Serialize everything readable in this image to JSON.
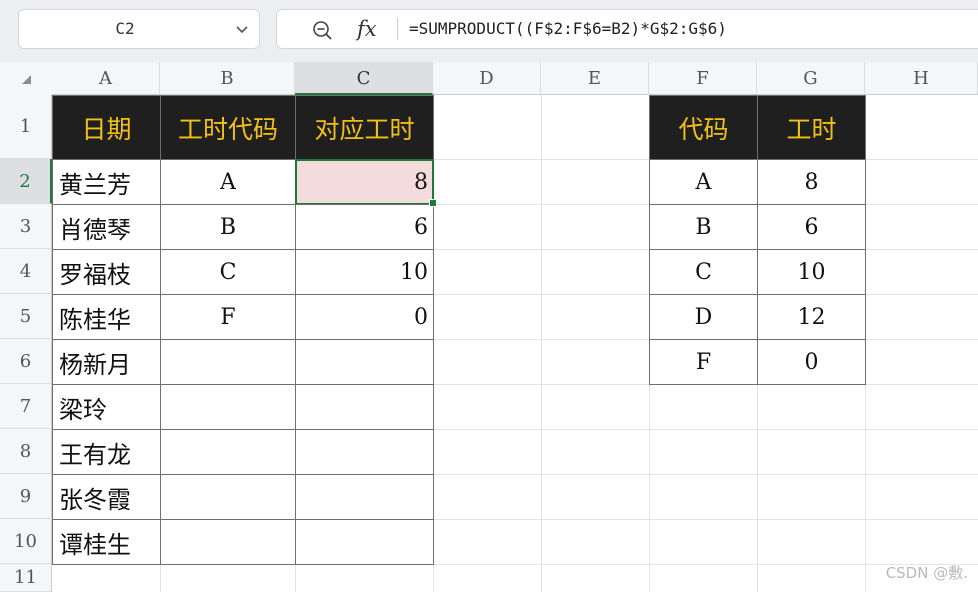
{
  "formula_bar": {
    "name_box": "C2",
    "fx_label": "fx",
    "formula": "=SUMPRODUCT((F$2:F$6=B2)*G$2:G$6)"
  },
  "columns": [
    "A",
    "B",
    "C",
    "D",
    "E",
    "F",
    "G",
    "H"
  ],
  "rows": [
    "1",
    "2",
    "3",
    "4",
    "5",
    "6",
    "7",
    "8",
    "9",
    "10",
    "11"
  ],
  "left_table": {
    "headers": [
      "日期",
      "工时代码",
      "对应工时"
    ],
    "rows": [
      {
        "name": "黄兰芳",
        "code": "A",
        "hours": "8"
      },
      {
        "name": "肖德琴",
        "code": "B",
        "hours": "6"
      },
      {
        "name": "罗福枝",
        "code": "C",
        "hours": "10"
      },
      {
        "name": "陈桂华",
        "code": "F",
        "hours": "0"
      },
      {
        "name": "杨新月",
        "code": "",
        "hours": ""
      },
      {
        "name": "梁玲",
        "code": "",
        "hours": ""
      },
      {
        "name": "王有龙",
        "code": "",
        "hours": ""
      },
      {
        "name": "张冬霞",
        "code": "",
        "hours": ""
      },
      {
        "name": "谭桂生",
        "code": "",
        "hours": ""
      }
    ]
  },
  "right_table": {
    "headers": [
      "代码",
      "工时"
    ],
    "rows": [
      {
        "code": "A",
        "hours": "8"
      },
      {
        "code": "B",
        "hours": "6"
      },
      {
        "code": "C",
        "hours": "10"
      },
      {
        "code": "D",
        "hours": "12"
      },
      {
        "code": "F",
        "hours": "0"
      }
    ]
  },
  "watermark": "CSDN @敷.",
  "colors": {
    "header_bg": "#1f1f1f",
    "header_text": "#f2c019",
    "selection": "#1f7a3a",
    "active_fill": "#f4dcdc"
  }
}
